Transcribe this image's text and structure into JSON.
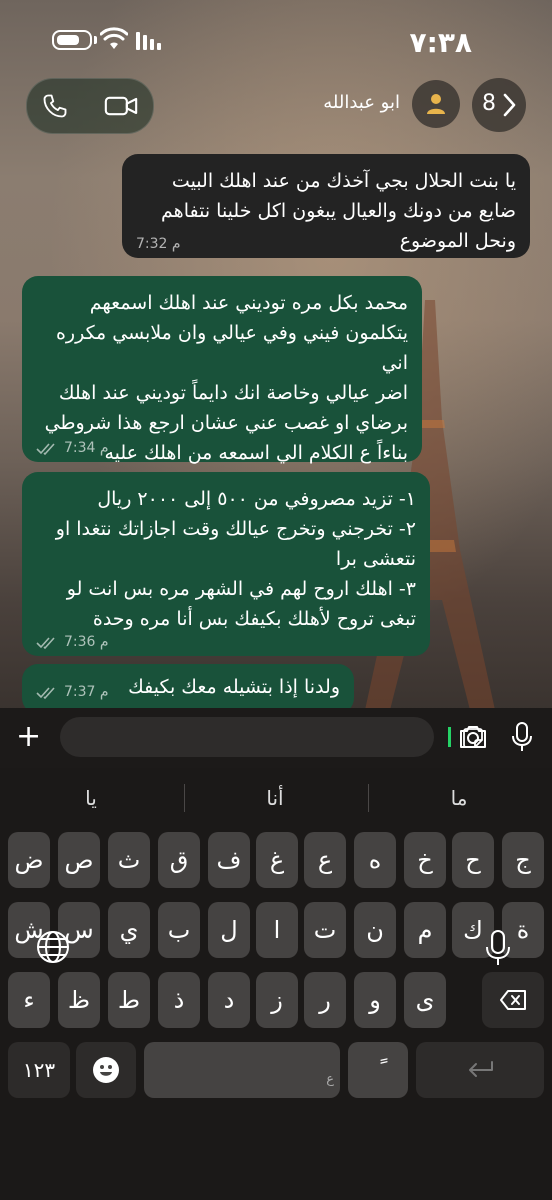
{
  "status_bar": {
    "time": "٧:٣٨"
  },
  "header": {
    "contact_name": "ابو عبدالله",
    "unread_count": "8"
  },
  "messages": [
    {
      "direction": "incoming",
      "text": "يا بنت الحلال بجي آخذك من عند اهلك البيت\nضايع من دونك والعيال يبغون اكل خلينا نتفاهم\nونحل الموضوع",
      "time": "7:32 م"
    },
    {
      "direction": "outgoing",
      "text": "محمد بكل مره توديني عند اهلك اسمعهم\nيتكلمون فيني وفي عيالي وان ملابسي مكرره اني\nاضر عيالي وخاصة انك دايماً توديني عند اهلك\nبرضاي او غصب عني عشان ارجع هذا شروطي\nبناءاً ع الكلام الي اسمعه من اهلك عليه",
      "time": "7:34 م"
    },
    {
      "direction": "outgoing",
      "text": "١- تزيد مصروفي من ٥٠٠ إلى ٢٠٠٠ ريال\n٢- تخرجني وتخرج عيالك وقت اجازاتك نتغدا او\nنتعشى برا\n٣- اهلك اروح لهم في الشهر مره بس انت لو\nتبغى تروح لأهلك بكيفك بس أنا مره وحدة",
      "time": "7:36 م"
    },
    {
      "direction": "outgoing",
      "text": "ولدنا إذا بتشيله معك بكيفك",
      "time": "7:37 م"
    }
  ],
  "keyboard": {
    "suggestions": [
      "يا",
      "أنا",
      "ما"
    ],
    "row1": [
      "ض",
      "ص",
      "ث",
      "ق",
      "ف",
      "غ",
      "ع",
      "ه",
      "خ",
      "ح",
      "ج"
    ],
    "row2": [
      "ش",
      "س",
      "ي",
      "ب",
      "ل",
      "ا",
      "ت",
      "ن",
      "م",
      "ك",
      "ة"
    ],
    "row3": [
      "ء",
      "ظ",
      "ط",
      "ذ",
      "د",
      "ز",
      "ر",
      "و",
      "ى"
    ],
    "numbers_label": "١٢٣",
    "space_hint": "ع",
    "tanween_key": "ً"
  }
}
